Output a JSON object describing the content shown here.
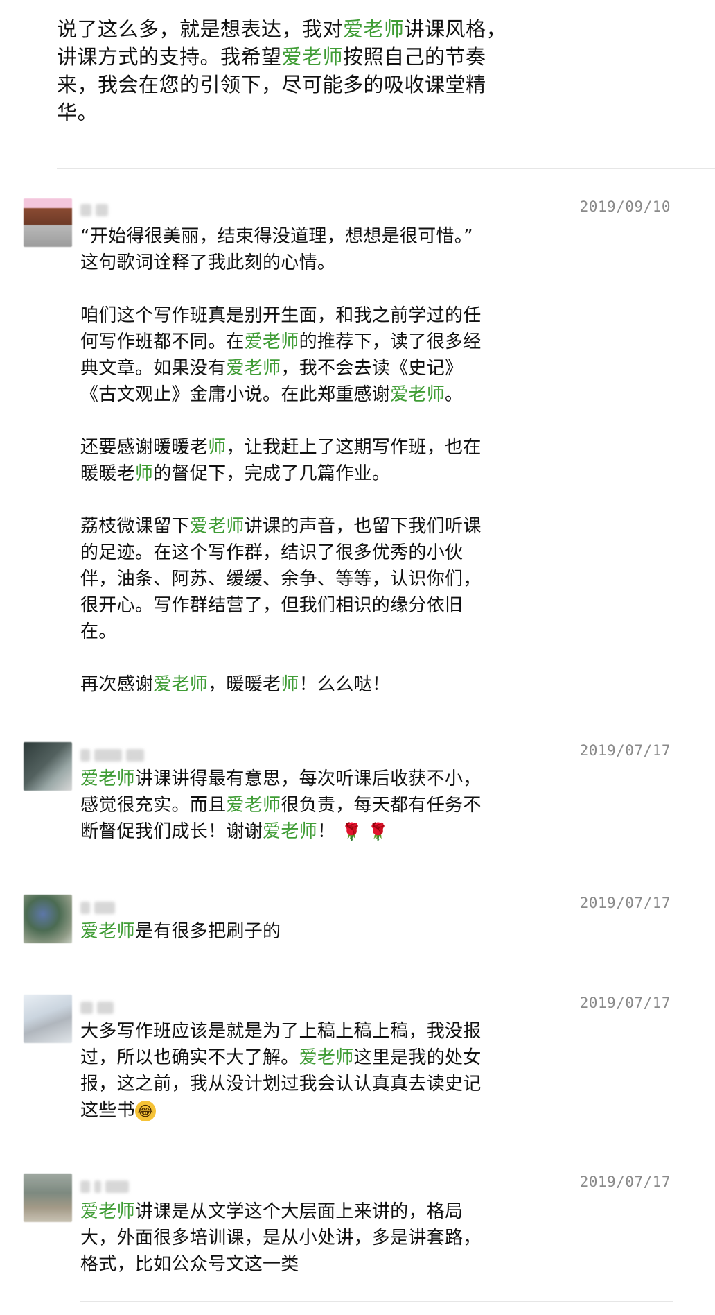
{
  "intro": {
    "line1_a": "说了这么多，就是想表达，我对",
    "line1_hl": "爱老师",
    "line1_b": "讲课风格，",
    "line2_a": "讲课方式的支持。我希望",
    "line2_hl": "爱老师",
    "line2_b": "按照自己的节奏",
    "line3": "来，我会在您的引领下，尽可能多的吸收课堂精",
    "line4": "华。"
  },
  "comments": [
    {
      "date": "2019/09/10",
      "p1_l1": "“开始得很美丽，结束得没道理，想想是很可惜。”",
      "p1_l2": "这句歌词诠释了我此刻的心情。",
      "p2_l1": "咱们这个写作班真是别开生面，和我之前学过的任",
      "p2_l2a": "何写作班都不同。在",
      "p2_l2hl": "爱老师",
      "p2_l2b": "的推荐下，读了很多经",
      "p2_l3a": "典文章。如果没有",
      "p2_l3hl": "爱老师",
      "p2_l3b": "，我不会去读《史记》",
      "p2_l4a": "《古文观止》金庸小说。在此郑重感谢",
      "p2_l4hl": "爱老师",
      "p2_l4b": "。",
      "p3_l1a": "还要感谢暖暖老",
      "p3_l1hl": "师",
      "p3_l1b": "，让我赶上了这期写作班，也在",
      "p3_l2a": "暖暖老",
      "p3_l2hl": "师",
      "p3_l2b": "的督促下，完成了几篇作业。",
      "p4_l1a": "荔枝微课留下",
      "p4_l1hl": "爱老师",
      "p4_l1b": "讲课的声音，也留下我们听课",
      "p4_l2": "的足迹。在这个写作群，结识了很多优秀的小伙",
      "p4_l3": "伴，油条、阿苏、缓缓、余争、等等，认识你们，",
      "p4_l4": "很开心。写作群结营了，但我们相识的缘分依旧",
      "p4_l5": "在。",
      "p5_a": "再次感谢",
      "p5_hl1": "爱老师",
      "p5_b": "，暖暖老",
      "p5_hl2": "师",
      "p5_c": "！么么哒！"
    },
    {
      "date": "2019/07/17",
      "l1hl": "爱老师",
      "l1": "讲课讲得最有意思，每次听课后收获不小，",
      "l2a": "感觉很充实。而且",
      "l2hl": "爱老师",
      "l2b": "很负责，每天都有任务不",
      "l3a": "断督促我们成长！谢谢",
      "l3hl": "爱老师",
      "l3b": "！",
      "emoji": "🌹 🌹"
    },
    {
      "date": "2019/07/17",
      "l1hl": "爱老师",
      "l1": "是有很多把刷子的"
    },
    {
      "date": "2019/07/17",
      "l1": "大多写作班应该是就是为了上稿上稿上稿，我没报",
      "l2a": "过，所以也确实不大了解。",
      "l2hl": "爱老师",
      "l2b": "这里是我的处女",
      "l3": "报，这之前，我从没计划过我会认认真真去读史记",
      "l4": "这些书",
      "emoji": "😂"
    },
    {
      "date": "2019/07/17",
      "l1hl": "爱老师",
      "l1": "讲课是从文学这个大层面上来讲的，格局",
      "l2": "大，外面很多培训课，是从小处讲，多是讲套路，",
      "l3": "格式，比如公众号文这一类"
    }
  ],
  "colors": {
    "highlight": "#3f9c35",
    "date": "#8a8a8a",
    "divider": "#e6e6e6"
  }
}
